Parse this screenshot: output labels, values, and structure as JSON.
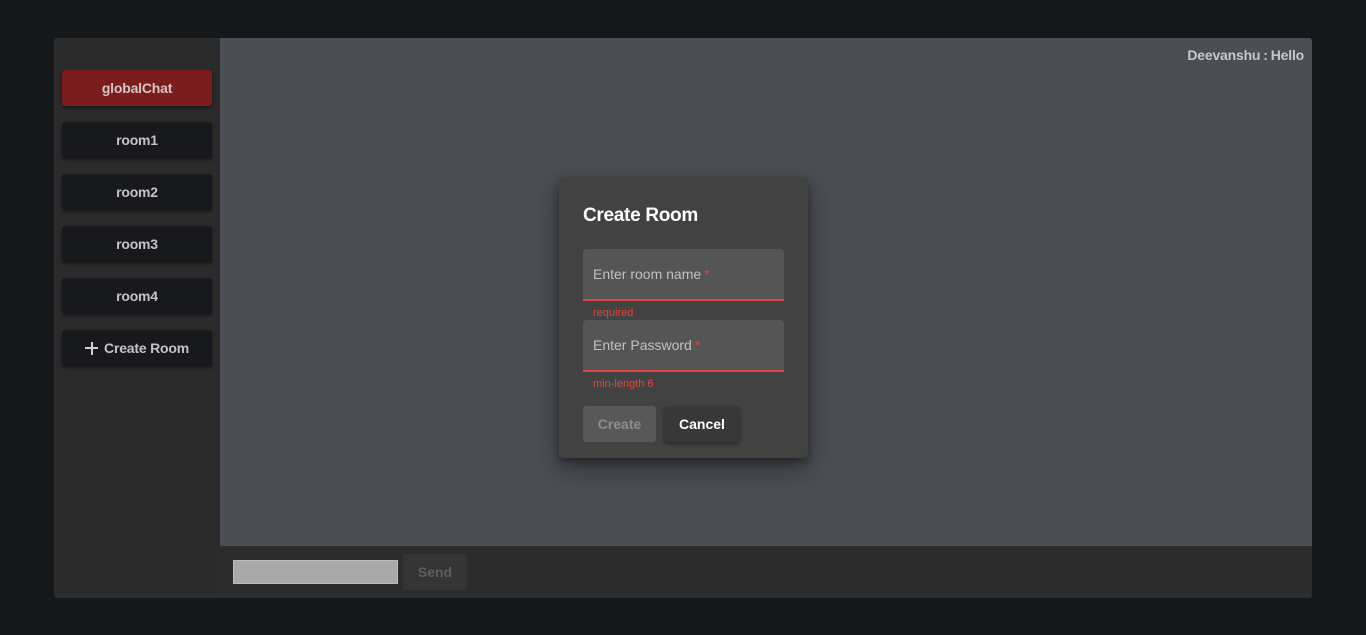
{
  "sidebar": {
    "items": [
      {
        "label": "globalChat",
        "active": true
      },
      {
        "label": "room1"
      },
      {
        "label": "room2"
      },
      {
        "label": "room3"
      },
      {
        "label": "room4"
      }
    ],
    "create_room_label": "Create Room",
    "create_room_icon": "plus-icon"
  },
  "chat": {
    "messages": [
      {
        "user": "Deevanshu",
        "separator": ":",
        "text": "Hello"
      }
    ]
  },
  "composer": {
    "input_value": "",
    "send_label": "Send"
  },
  "dialog": {
    "title": "Create Room",
    "room_name_label": "Enter room name",
    "room_name_required_marker": "*",
    "room_name_error": "required",
    "password_label": "Enter Password",
    "password_required_marker": "*",
    "password_error": "min-length 6",
    "create_label": "Create",
    "cancel_label": "Cancel"
  },
  "colors": {
    "active_room": "#7c1d1d",
    "error": "#e0483e",
    "chat_background": "#4b4e55"
  }
}
